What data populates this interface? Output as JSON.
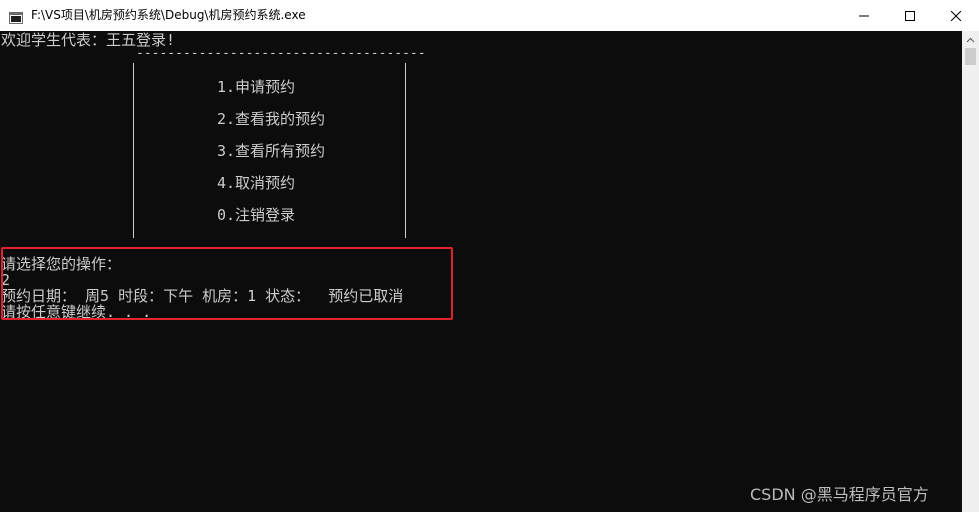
{
  "window": {
    "title": "F:\\VS项目\\机房预约系统\\Debug\\机房预约系统.exe"
  },
  "console": {
    "welcome": "欢迎学生代表：王五登录!",
    "divider": "-------------------------------------",
    "menu": [
      "1.申请预约",
      "2.查看我的预约",
      "3.查看所有预约",
      "4.取消预约",
      "0.注销登录"
    ],
    "prompt": "请选择您的操作：",
    "input": "2",
    "result": "预约日期： 周5 时段：下午 机房：1 状态：  预约已取消",
    "continue": "请按任意键继续. . ."
  },
  "watermark": "CSDN @黑马程序员官方",
  "colors": {
    "console_bg": "#0c0c0c",
    "console_text": "#cccccc",
    "highlight_border": "#e0232f",
    "titlebar_bg": "#ffffff"
  },
  "icons": {
    "app": "console-app-icon",
    "minimize": "minimize-icon",
    "maximize": "maximize-icon",
    "close": "close-icon"
  }
}
